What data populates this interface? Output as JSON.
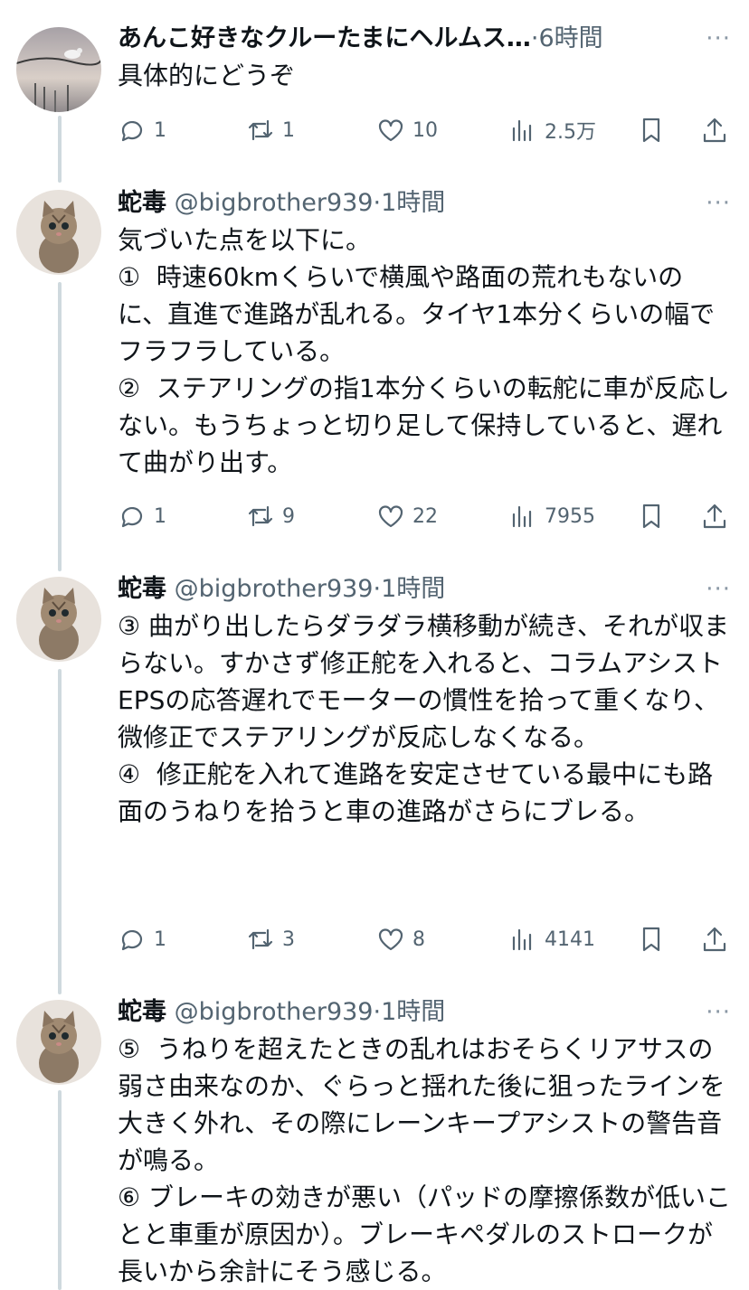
{
  "tweets": [
    {
      "name": "あんこ好きなクルーたまにヘルムス…",
      "handle": "",
      "time": "6時間",
      "text": "具体的にどうぞ",
      "replies": "1",
      "retweets": "1",
      "likes": "10",
      "views": "2.5万"
    },
    {
      "name": "蛇毒",
      "handle": "@bigbrother939",
      "time": "1時間",
      "text": "気づいた点を以下に。\n①  時速60kmくらいで横風や路面の荒れもないのに、直進で進路が乱れる。タイヤ1本分くらいの幅でフラフラしている。\n②  ステアリングの指1本分くらいの転舵に車が反応しない。もうちょっと切り足して保持していると、遅れて曲がり出す。",
      "replies": "1",
      "retweets": "9",
      "likes": "22",
      "views": "7955"
    },
    {
      "name": "蛇毒",
      "handle": "@bigbrother939",
      "time": "1時間",
      "text": "③ 曲がり出したらダラダラ横移動が続き、それが収まらない。すかさず修正舵を入れると、コラムアシストEPSの応答遅れでモーターの慣性を拾って重くなり、微修正でステアリングが反応しなくなる。\n④  修正舵を入れて進路を安定させている最中にも路面のうねりを拾うと車の進路がさらにブレる。",
      "replies": "1",
      "retweets": "3",
      "likes": "8",
      "views": "4141"
    },
    {
      "name": "蛇毒",
      "handle": "@bigbrother939",
      "time": "1時間",
      "text": "⑤  うねりを超えたときの乱れはおそらくリアサスの弱さ由来なのか、ぐらっと揺れた後に狙ったラインを大きく外れ、その際にレーンキープアシストの警告音が鳴る。\n⑥ ブレーキの効きが悪い（パッドの摩擦係数が低いことと車重が原因か）。ブレーキペダルのストロークが長いから余計にそう感じる。"
    }
  ],
  "ui": {
    "separator": "·",
    "more": "···"
  },
  "colors": {
    "text": "#0f1419",
    "secondary": "#536471",
    "thread_line": "#cfd9de"
  },
  "icons": {
    "reply": "speech-bubble-icon",
    "retweet": "retweet-arrows-icon",
    "like": "heart-icon",
    "views": "bar-chart-icon",
    "bookmark": "bookmark-icon",
    "share": "share-upload-icon"
  }
}
